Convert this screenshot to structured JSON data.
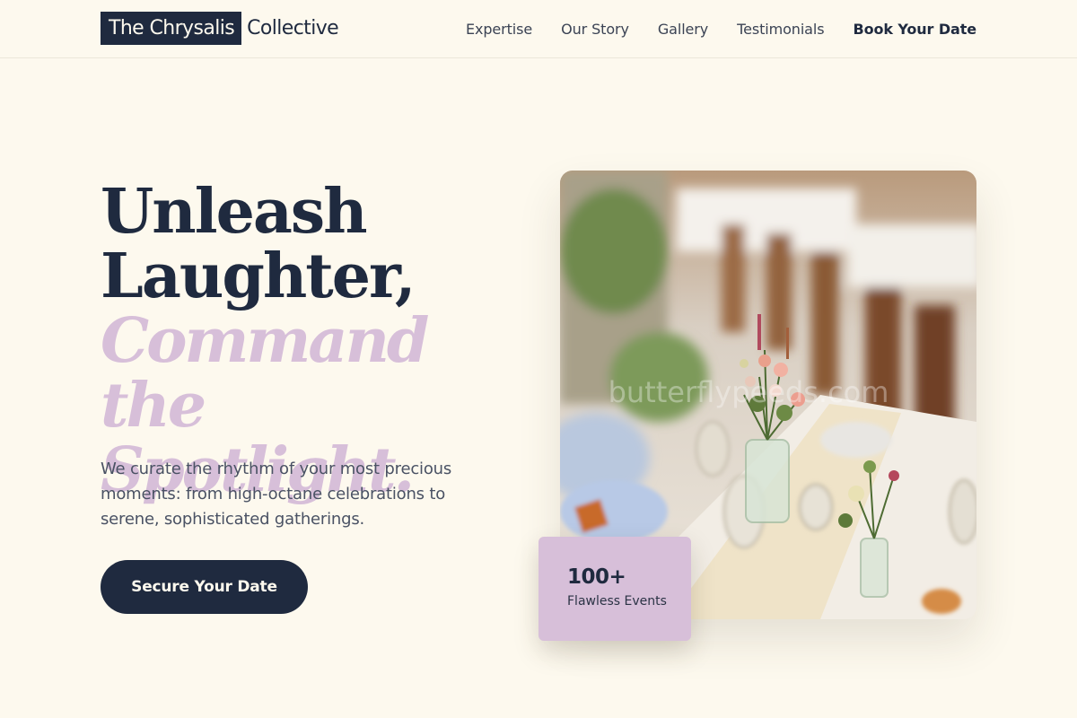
{
  "header": {
    "logo_boxed": "The Chrysalis",
    "logo_rest": "Collective",
    "nav": [
      {
        "label": "Expertise"
      },
      {
        "label": "Our Story"
      },
      {
        "label": "Gallery"
      },
      {
        "label": "Testimonials"
      },
      {
        "label": "Book Your Date"
      }
    ]
  },
  "hero": {
    "headline_line1": "Unleash",
    "headline_line2": "Laughter,",
    "headline_accent_line1": "Command the",
    "headline_accent_line2": "Spotlight.",
    "subtext": "We curate the rhythm of your most precious moments: from high-octane celebrations to serene, sophisticated gatherings.",
    "cta_label": "Secure Your Date",
    "image_watermark": "butterflypeeds.com"
  },
  "stat": {
    "number": "100+",
    "label": "Flawless Events"
  },
  "colors": {
    "background": "#fdf9ee",
    "navy": "#1f2a3f",
    "lilac": "#d7bfd9"
  }
}
